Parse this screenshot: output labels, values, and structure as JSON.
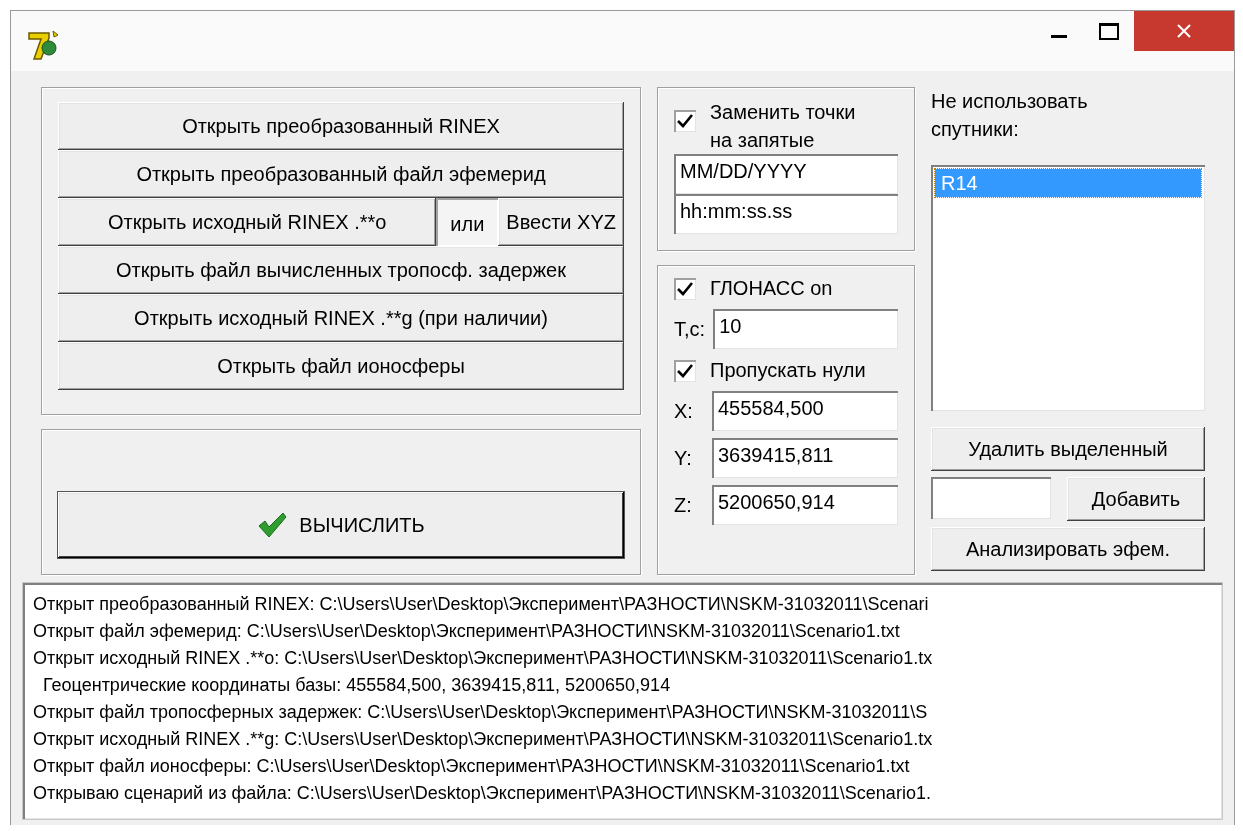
{
  "file_buttons": [
    [
      {
        "kind": "button",
        "label": "Открыть преобразованный RINEX"
      }
    ],
    [
      {
        "kind": "button",
        "label": "Открыть преобразованный файл эфемерид"
      }
    ],
    [
      {
        "kind": "button",
        "label": "Открыть исходный RINEX .**o"
      },
      {
        "kind": "label",
        "label": "или"
      },
      {
        "kind": "button",
        "label": "Ввести XYZ"
      }
    ],
    [
      {
        "kind": "button",
        "label": "Открыть файл вычисленных тропосф. задержек"
      }
    ],
    [
      {
        "kind": "button",
        "label": "Открыть исходный RINEX .**g (при наличии)"
      }
    ],
    [
      {
        "kind": "button",
        "label": "Открыть файл ионосферы"
      }
    ]
  ],
  "compute_button": {
    "label": "ВЫЧИСЛИТЬ"
  },
  "replace_commas": {
    "label": "Заменить точки на запятые",
    "checked": true
  },
  "date_field": {
    "value": "MM/DD/YYYY"
  },
  "time_field": {
    "value": "hh:mm:ss.ss"
  },
  "glonass": {
    "label": "ГЛОНАСС on",
    "checked": true
  },
  "period": {
    "label": "T,c:",
    "value": "10"
  },
  "skip_zeros": {
    "label": "Пропускать нули",
    "checked": true
  },
  "coordinates": [
    {
      "label": "X:",
      "value": "455584,500"
    },
    {
      "label": "Y:",
      "value": "3639415,811"
    },
    {
      "label": "Z:",
      "value": "5200650,914"
    }
  ],
  "exclude_satellites": {
    "label": "Не использовать спутники:",
    "items": [
      {
        "text": "R14",
        "selected": true
      }
    ]
  },
  "delete_button": {
    "label": "Удалить выделенный"
  },
  "add_button": {
    "label": "Добавить"
  },
  "analyze_button": {
    "label": "Анализировать эфем."
  },
  "log": [
    "Открыт преобразованный RINEX: C:\\Users\\User\\Desktop\\Эксперимент\\РАЗНОСТИ\\NSKM-31032011\\Scenari",
    "Открыт файл эфемерид: C:\\Users\\User\\Desktop\\Эксперимент\\РАЗНОСТИ\\NSKM-31032011\\Scenario1.txt",
    "Открыт исходный RINEX .**o: C:\\Users\\User\\Desktop\\Эксперимент\\РАЗНОСТИ\\NSKM-31032011\\Scenario1.tx",
    "  Геоцентрические координаты базы: 455584,500, 3639415,811, 5200650,914",
    "Открыт файл тропосферных задержек: C:\\Users\\User\\Desktop\\Эксперимент\\РАЗНОСТИ\\NSKM-31032011\\S",
    "Открыт исходный RINEX .**g: C:\\Users\\User\\Desktop\\Эксперимент\\РАЗНОСТИ\\NSKM-31032011\\Scenario1.tx",
    "Открыт файл ионосферы: C:\\Users\\User\\Desktop\\Эксперимент\\РАЗНОСТИ\\NSKM-31032011\\Scenario1.txt",
    "Открываю сценарий из файла: C:\\Users\\User\\Desktop\\Эксперимент\\РАЗНОСТИ\\NSKM-31032011\\Scenario1."
  ]
}
